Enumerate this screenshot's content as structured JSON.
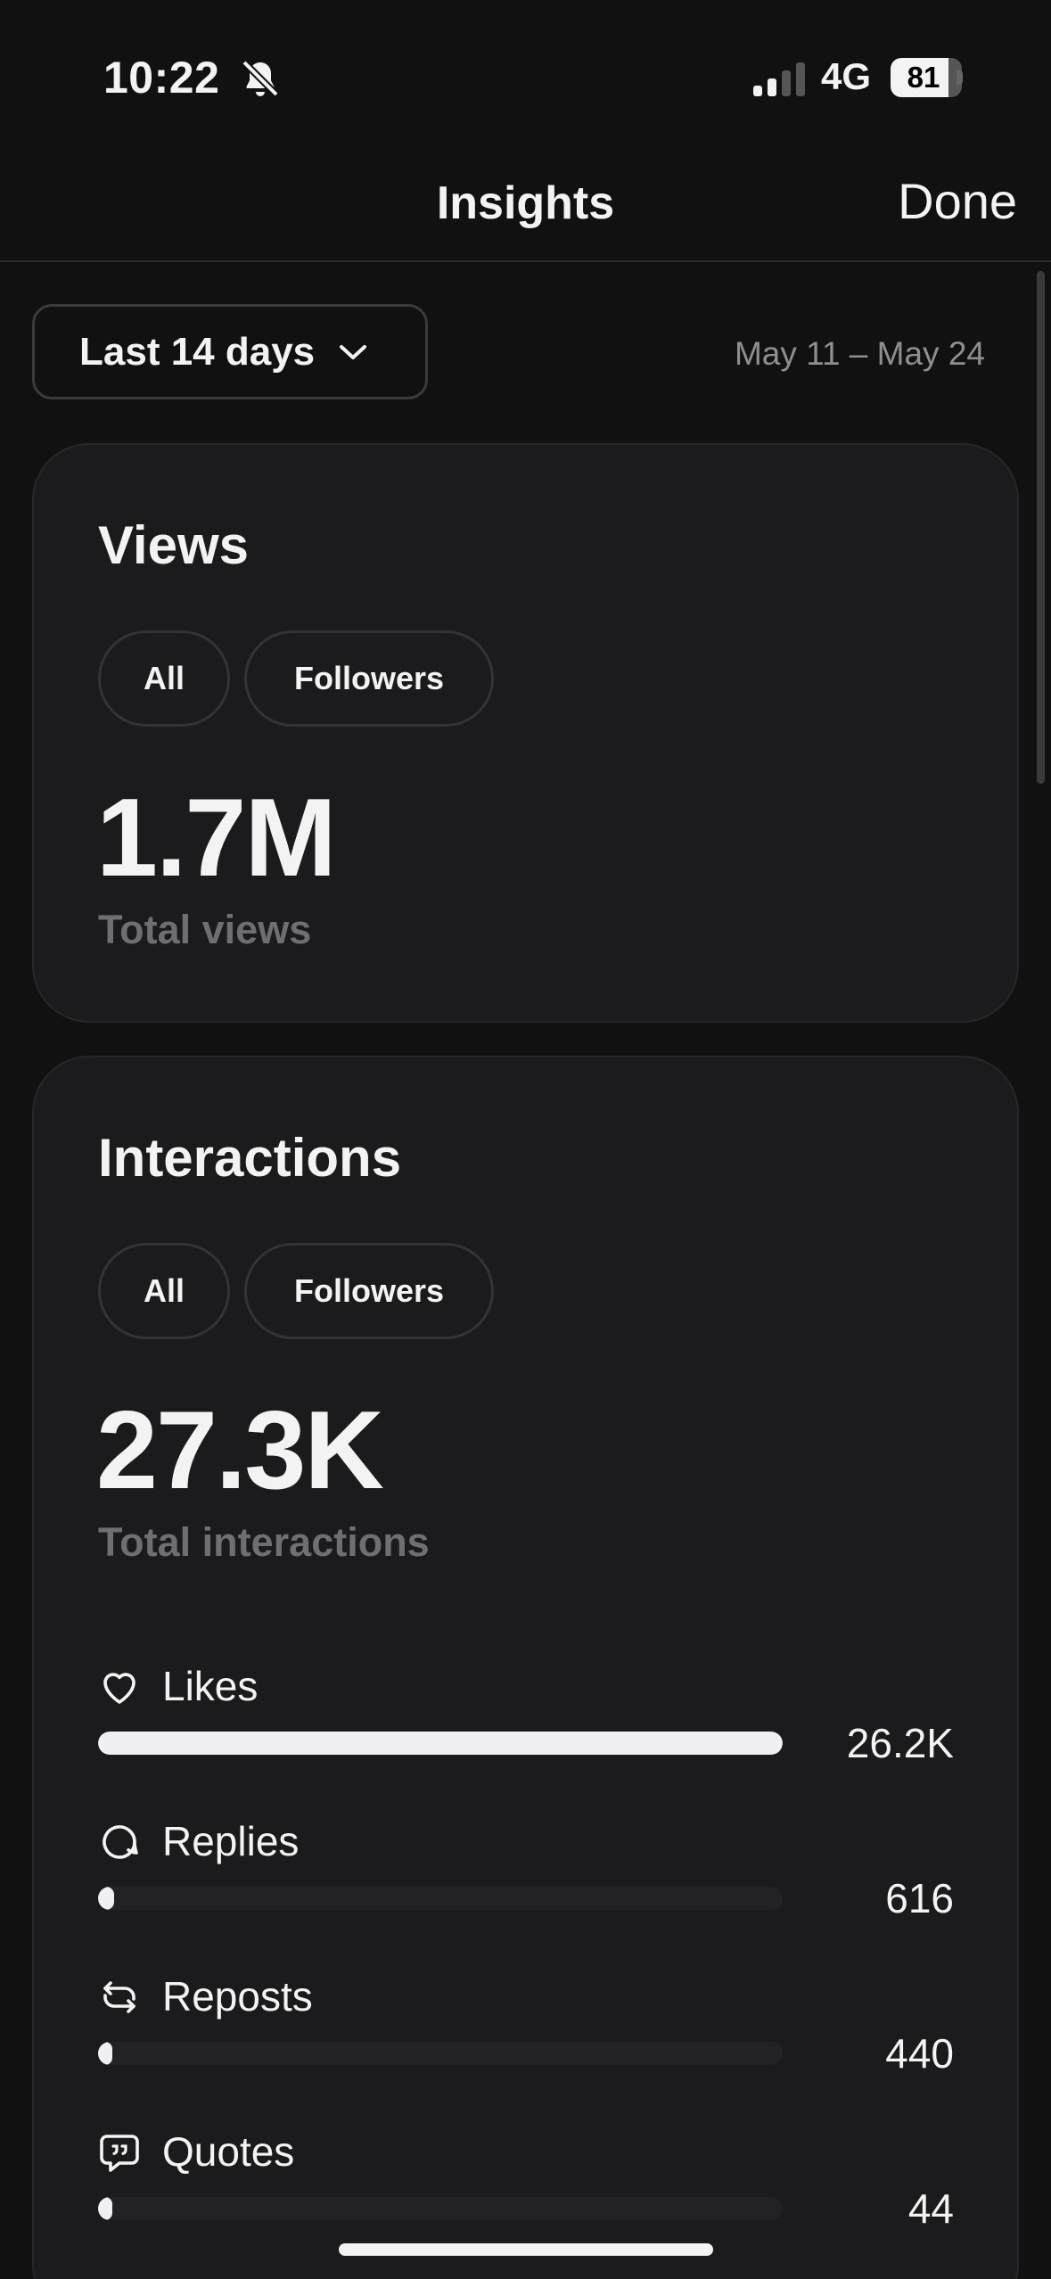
{
  "status_bar": {
    "time": "10:22",
    "network": "4G",
    "battery_level": "81"
  },
  "nav": {
    "title": "Insights",
    "done_label": "Done"
  },
  "range": {
    "selected": "Last 14 days",
    "dates": "May 11 – May 24"
  },
  "views": {
    "title": "Views",
    "filters": [
      "All",
      "Followers"
    ],
    "total": "1.7M",
    "total_label": "Total views"
  },
  "interactions": {
    "title": "Interactions",
    "filters": [
      "All",
      "Followers"
    ],
    "total": "27.3K",
    "total_label": "Total interactions",
    "metrics": [
      {
        "name": "Likes",
        "value": "26.2K",
        "share": 1.0,
        "icon": "heart-icon"
      },
      {
        "name": "Replies",
        "value": "616",
        "share": 0.0235,
        "icon": "reply-bubble-icon"
      },
      {
        "name": "Reposts",
        "value": "440",
        "share": 0.0168,
        "icon": "repost-icon"
      },
      {
        "name": "Quotes",
        "value": "44",
        "share": 0.0017,
        "icon": "quote-bubble-icon"
      }
    ]
  },
  "colors": {
    "background": "#111112",
    "card": "#1b1b1d",
    "text": "#f3f3f3",
    "muted": "#6e6e73",
    "bar": "#f0f0f2",
    "track": "#222225"
  }
}
